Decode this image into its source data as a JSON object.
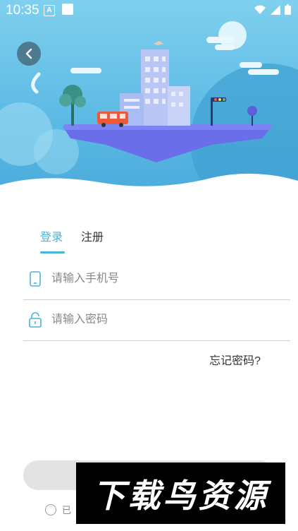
{
  "status": {
    "time": "10:35",
    "a_label": "A"
  },
  "tabs": [
    {
      "label": "登录",
      "active": true
    },
    {
      "label": "注册",
      "active": false
    }
  ],
  "phone": {
    "placeholder": "请输入手机号"
  },
  "password": {
    "placeholder": "请输入密码"
  },
  "forgot_label": "忘记密码?",
  "agree_label": "已",
  "watermark_text": "下载鸟资源",
  "colors": {
    "accent": "#4ab3d9",
    "sky": "#5bb9e4",
    "island": "#6a6ee8"
  }
}
